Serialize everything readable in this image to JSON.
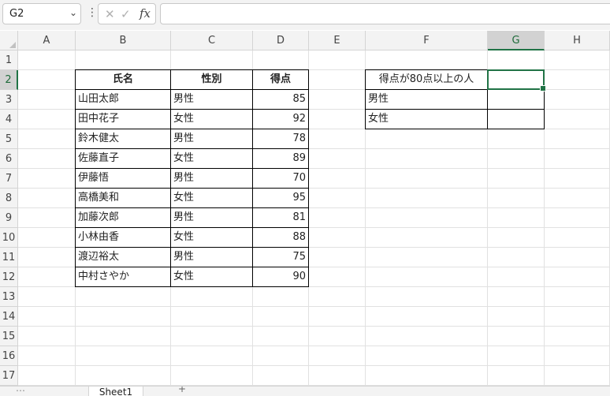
{
  "formula_bar": {
    "name_box": "G2",
    "fx_label": "fx",
    "formula": ""
  },
  "columns": [
    "A",
    "B",
    "C",
    "D",
    "E",
    "F",
    "G",
    "H"
  ],
  "rows": [
    "1",
    "2",
    "3",
    "4",
    "5",
    "6",
    "7",
    "8",
    "9",
    "10",
    "11",
    "12",
    "13",
    "14",
    "15",
    "16",
    "17"
  ],
  "selected_cell": "G2",
  "table": {
    "headers": [
      "氏名",
      "性別",
      "得点"
    ],
    "rows": [
      [
        "山田太郎",
        "男性",
        "85"
      ],
      [
        "田中花子",
        "女性",
        "92"
      ],
      [
        "鈴木健太",
        "男性",
        "78"
      ],
      [
        "佐藤直子",
        "女性",
        "89"
      ],
      [
        "伊藤悟",
        "男性",
        "70"
      ],
      [
        "高橋美和",
        "女性",
        "95"
      ],
      [
        "加藤次郎",
        "男性",
        "81"
      ],
      [
        "小林由香",
        "女性",
        "88"
      ],
      [
        "渡辺裕太",
        "男性",
        "75"
      ],
      [
        "中村さやか",
        "女性",
        "90"
      ]
    ]
  },
  "summary": {
    "title": "得点が80点以上の人",
    "rows": [
      "男性",
      "女性"
    ]
  },
  "sheet_tabs": {
    "active": "Sheet1"
  },
  "colors": {
    "accent": "#217346",
    "header_bg": "#f3f3f3",
    "gridline": "#e1e1e1"
  }
}
